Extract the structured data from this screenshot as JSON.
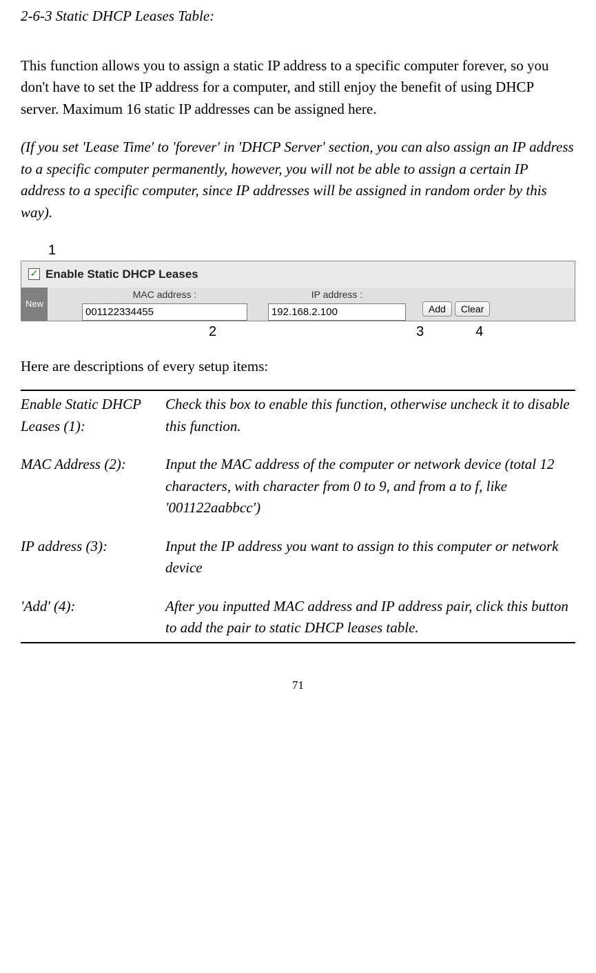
{
  "section_title": "2-6-3 Static DHCP Leases Table:",
  "intro": "This function allows you to assign a static IP address to a specific computer forever, so you don't have to set the IP address for a computer, and still enjoy the benefit of using DHCP server. Maximum 16 static IP addresses can be assigned here.",
  "note": "(If you set 'Lease Time' to 'forever' in 'DHCP Server' section, you can also assign an IP address to a specific computer permanently, however, you will not be able to assign a certain IP address to a specific computer, since IP addresses will be assigned in random order by this way).",
  "annotations": {
    "above": "1",
    "below": [
      "2",
      "3",
      "4"
    ]
  },
  "ui": {
    "checkbox_checked": "✓",
    "enable_label": "Enable Static DHCP Leases",
    "new_label": "New",
    "mac_label": "MAC address :",
    "mac_value": "001122334455",
    "ip_label": "IP address :",
    "ip_value": "192.168.2.100",
    "add_btn": "Add",
    "clear_btn": "Clear"
  },
  "table_intro": "Here are descriptions of every setup items:",
  "rows": [
    {
      "label": "Enable Static DHCP Leases (1):",
      "desc": "Check this box to enable this function, otherwise uncheck it to disable this function."
    },
    {
      "label": "MAC Address (2):",
      "desc": "Input the MAC address of the computer or network device (total 12 characters, with character from 0 to 9, and from a to f, like '001122aabbcc')"
    },
    {
      "label": "IP address (3):",
      "desc": "Input the IP address you want to assign to this computer or network device"
    },
    {
      "label": "'Add' (4):",
      "desc": "After you inputted MAC address and IP address pair, click this button to add the pair to static DHCP leases table."
    }
  ],
  "page_number": "71"
}
